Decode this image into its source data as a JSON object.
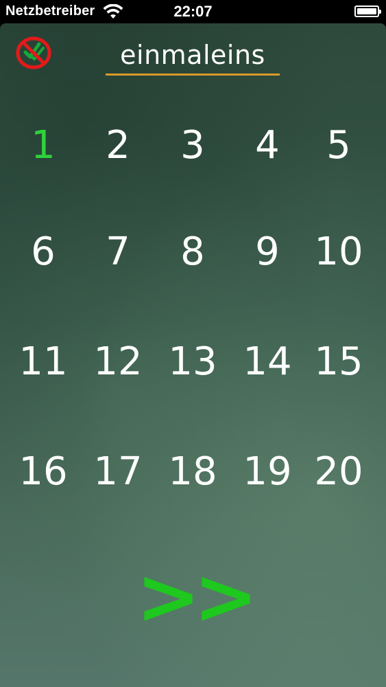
{
  "status_bar": {
    "carrier": "Netzbetreiber",
    "time": "22:07",
    "wifi_icon": "wifi-icon",
    "battery_icon": "battery-icon"
  },
  "header": {
    "title": "einmaleins",
    "mute_icon": "mute-sound-icon"
  },
  "numbers": [
    "1",
    "2",
    "3",
    "4",
    "5",
    "6",
    "7",
    "8",
    "9",
    "10",
    "11",
    "12",
    "13",
    "14",
    "15",
    "16",
    "17",
    "18",
    "19",
    "20"
  ],
  "selected_number": "1",
  "next_button": {
    "label": ">>"
  },
  "colors": {
    "board": "#36574a",
    "title_underline": "#d99a2b",
    "selected": "#2fd23a",
    "next": "#1ec81e",
    "mute_icon": "#e21a1a"
  }
}
